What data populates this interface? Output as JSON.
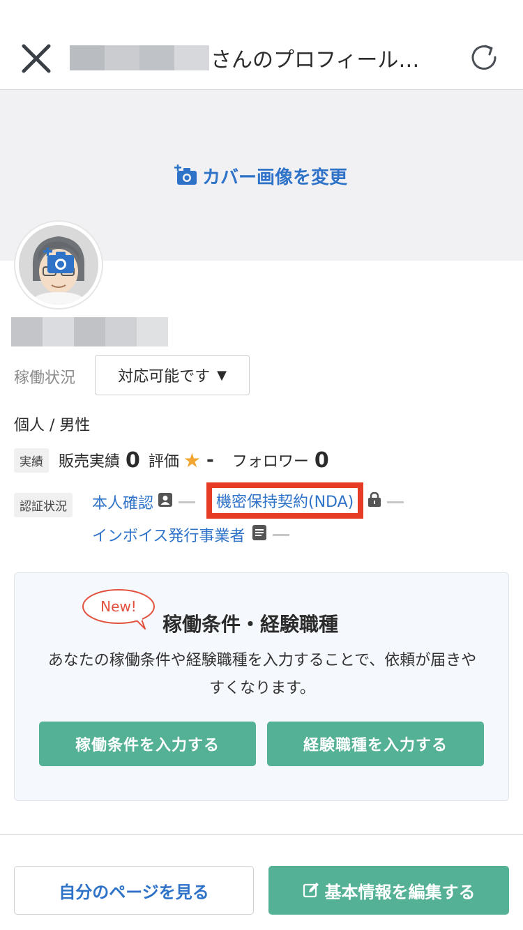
{
  "header": {
    "title_suffix": "さんのプロフィール…",
    "close_icon": "close-icon",
    "reload_icon": "reload-icon"
  },
  "cover": {
    "change_label": "カバー画像を変更",
    "icon": "camera-plus-icon"
  },
  "profile": {
    "status_label": "稼働状況",
    "status_value": "対応可能です",
    "caret": "▼",
    "type_gender": "個人 / 男性"
  },
  "stats": {
    "tag": "実績",
    "sales_label": "販売実績",
    "sales_value": "0",
    "rating_label": "評価",
    "rating_value": "-",
    "followers_label": "フォロワー",
    "followers_value": "0"
  },
  "certification": {
    "tag": "認証状況",
    "identity": "本人確認",
    "nda": "機密保持契約(NDA)",
    "invoice": "インボイス発行事業者"
  },
  "card": {
    "new_badge": "New!",
    "title": "稼働条件・経験職種",
    "description": "あなたの稼働条件や経験職種を入力することで、依頼が届きやすくなります。",
    "button_conditions": "稼働条件を入力する",
    "button_experience": "経験職種を入力する"
  },
  "footer": {
    "view_page": "自分のページを見る",
    "edit_info": "基本情報を編集する"
  },
  "colors": {
    "link_blue": "#2f73c9",
    "green": "#55b195",
    "highlight_red": "#e63c26",
    "star_orange": "#f2a531"
  }
}
